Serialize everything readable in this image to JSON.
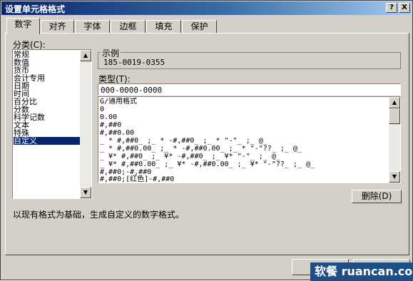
{
  "window": {
    "title": "设置单元格格式",
    "help_glyph": "?",
    "close_glyph": "X"
  },
  "tabs": [
    {
      "label": "数字"
    },
    {
      "label": "对齐"
    },
    {
      "label": "字体"
    },
    {
      "label": "边框"
    },
    {
      "label": "填充"
    },
    {
      "label": "保护"
    }
  ],
  "category": {
    "label": "分类(C):",
    "items": [
      "常规",
      "数值",
      "货币",
      "会计专用",
      "日期",
      "时间",
      "百分比",
      "分数",
      "科学记数",
      "文本",
      "特殊",
      "自定义"
    ],
    "selected": "自定义"
  },
  "sample": {
    "label": "示例",
    "value": "185-0019-0355"
  },
  "type": {
    "label": "类型(T):",
    "value": "000-0000-0000",
    "formats": [
      "G/通用格式",
      "0",
      "0.00",
      "#,##0",
      "#,##0.00",
      "_ * #,##0_ ;_ * -#,##0_ ;_ * \"-\"_ ;_ @_",
      "_ * #,##0.00_ ;_ * -#,##0.00_ ;_ * \"-\"??_ ;_ @_",
      "_ ¥* #,##0_ ;_ ¥* -#,##0_ ;_ ¥* \"-\"_ ;_ @_",
      "_ ¥* #,##0.00_ ;_ ¥* -#,##0.00_ ;_ ¥* \"-\"??_ ;_ @_",
      "#,##0;-#,##0",
      "#,##0;[红色]-#,##0"
    ]
  },
  "delete_button": "删除(D)",
  "hint": "以现有格式为基础，生成自定义的数字格式。",
  "scroll": {
    "up": "▲",
    "down": "▼"
  },
  "watermark": "软餐 ruancan.com"
}
